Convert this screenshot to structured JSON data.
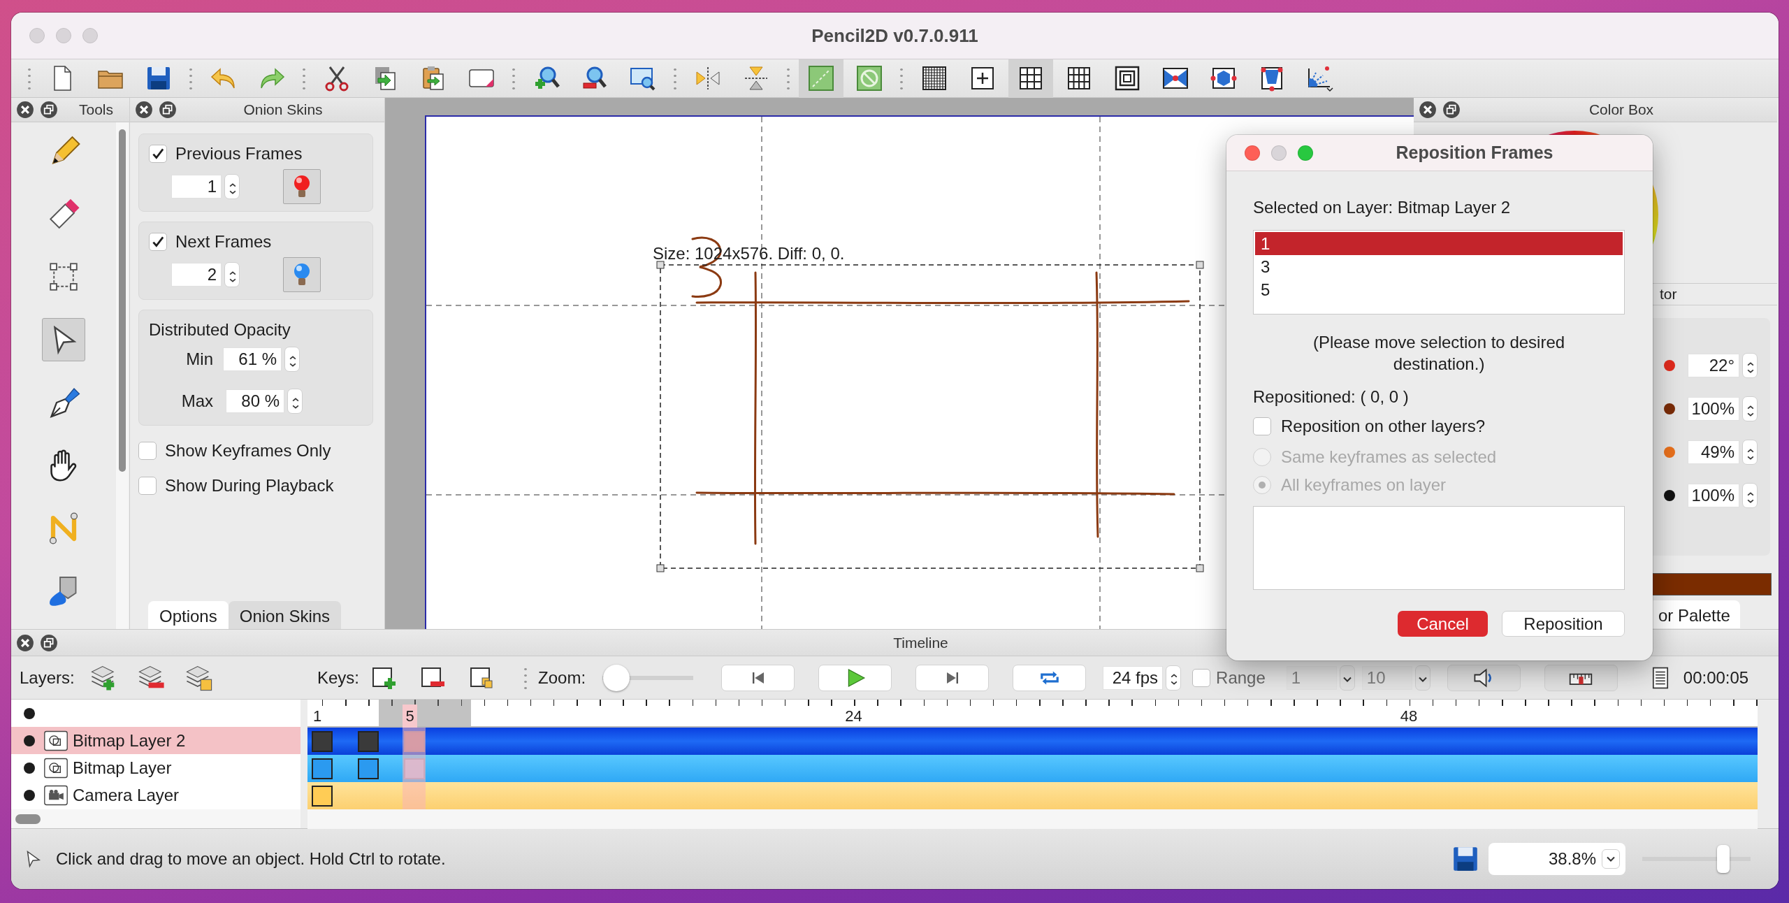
{
  "window": {
    "title": "Pencil2D v0.7.0.911"
  },
  "toolbar_groups": [
    [
      {
        "kind": "new",
        "on": false
      },
      {
        "kind": "open",
        "on": false
      },
      {
        "kind": "save",
        "on": false
      }
    ],
    [
      {
        "kind": "undo",
        "on": false
      },
      {
        "kind": "redo",
        "on": false
      }
    ],
    [
      {
        "kind": "cut",
        "on": false
      },
      {
        "kind": "copy",
        "on": false
      },
      {
        "kind": "paste",
        "on": false
      },
      {
        "kind": "clear",
        "on": false
      }
    ],
    [
      {
        "kind": "zoomin",
        "on": false
      },
      {
        "kind": "zoomout",
        "on": false
      },
      {
        "kind": "zoomfit",
        "on": false
      }
    ],
    [
      {
        "kind": "fliph",
        "on": false
      },
      {
        "kind": "flipv",
        "on": false
      }
    ],
    [
      {
        "kind": "onionprev",
        "on": true
      },
      {
        "kind": "onionnext",
        "on": false
      }
    ],
    [
      {
        "kind": "gridfine",
        "on": false
      },
      {
        "kind": "center",
        "on": false
      },
      {
        "kind": "thirds",
        "on": true
      },
      {
        "kind": "grid",
        "on": false
      },
      {
        "kind": "safe",
        "on": false
      },
      {
        "kind": "bowtie",
        "on": false
      },
      {
        "kind": "hexagon",
        "on": false
      },
      {
        "kind": "trapezoid",
        "on": false
      },
      {
        "kind": "fan",
        "on": false
      }
    ]
  ],
  "tools_panel": {
    "title": "Tools",
    "tools": [
      {
        "kind": "pencil",
        "selected": false
      },
      {
        "kind": "eraser",
        "selected": false
      },
      {
        "kind": "select",
        "selected": false
      },
      {
        "kind": "move",
        "selected": true
      },
      {
        "kind": "pen",
        "selected": false
      },
      {
        "kind": "hand",
        "selected": false
      },
      {
        "kind": "polyline",
        "selected": false
      },
      {
        "kind": "bucket",
        "selected": false
      }
    ]
  },
  "onion_panel": {
    "title": "Onion Skins",
    "previous_frames": {
      "label": "Previous Frames",
      "checked": true,
      "value": "1"
    },
    "next_frames": {
      "label": "Next Frames",
      "checked": true,
      "value": "2"
    },
    "opacity": {
      "title": "Distributed Opacity",
      "min_label": "Min",
      "min_value": "61 %",
      "max_label": "Max",
      "max_value": "80 %"
    },
    "options": [
      {
        "label": "Show Keyframes Only",
        "checked": false
      },
      {
        "label": "Show During Playback",
        "checked": false
      }
    ],
    "tabs": [
      {
        "label": "Options",
        "selected": true
      },
      {
        "label": "Onion Skins",
        "selected": false
      }
    ]
  },
  "canvas": {
    "selection_info": "Size: 1024x576. Diff: 0, 0."
  },
  "color_panel": {
    "title": "Color Box",
    "inspector_title": "tor",
    "values": [
      {
        "value": "22°",
        "color": "#e02a1c"
      },
      {
        "value": "100%",
        "color": "#7a2c08"
      },
      {
        "value": "49%",
        "color": "#e8701c"
      },
      {
        "value": "100%",
        "color": "#111111"
      }
    ],
    "tab": "or Palette"
  },
  "dialog": {
    "title": "Reposition Frames",
    "layer_label": "Selected on Layer: Bitmap Layer 2",
    "frames": [
      {
        "label": "1",
        "selected": true
      },
      {
        "label": "3",
        "selected": false
      },
      {
        "label": "5",
        "selected": false
      }
    ],
    "instruction": "(Please move selection to desired destination.)",
    "repositioned": "Repositioned: ( 0, 0 )",
    "other_layers": {
      "label": "Reposition on other layers?",
      "checked": false
    },
    "scope": [
      {
        "label": "Same keyframes as selected",
        "selected": false,
        "disabled": true
      },
      {
        "label": "All keyframes on layer",
        "selected": true,
        "disabled": true
      }
    ],
    "cancel": "Cancel",
    "confirm": "Reposition"
  },
  "timeline": {
    "title": "Timeline",
    "layers_label": "Layers:",
    "keys_label": "Keys:",
    "zoom_label": "Zoom:",
    "zoom": {
      "level": 0.2
    },
    "fps": "24 fps",
    "range": {
      "label": "Range",
      "checked": false
    },
    "range_start": "1",
    "range_end": "10",
    "time": "00:00:05",
    "ruler_labels": [
      {
        "text": "1",
        "current": false
      },
      {
        "text": "5",
        "current": true
      },
      {
        "text": "24",
        "current": false
      },
      {
        "text": "48",
        "current": false
      }
    ],
    "layers": [
      {
        "name": "Bitmap Layer 2",
        "kind": "bitmap",
        "selected": true,
        "cells": [
          {
            "kind": "key"
          },
          {
            "kind": "empty"
          },
          {
            "kind": "key"
          },
          {
            "kind": "empty"
          },
          {
            "kind": "ghost"
          }
        ]
      },
      {
        "name": "Bitmap Layer",
        "kind": "bitmap",
        "selected": false,
        "cells": [
          {
            "kind": "key"
          },
          {
            "kind": "empty"
          },
          {
            "kind": "key"
          },
          {
            "kind": "empty"
          },
          {
            "kind": "ghost"
          }
        ]
      },
      {
        "name": "Camera Layer",
        "kind": "camera",
        "selected": false,
        "cells": [
          {
            "kind": "key"
          },
          {
            "kind": "empty"
          },
          {
            "kind": "empty"
          },
          {
            "kind": "empty"
          },
          {
            "kind": "empty"
          }
        ]
      }
    ]
  },
  "status": {
    "message": "Click and drag to move an object. Hold Ctrl to rotate.",
    "zoom": "38.8%",
    "scale": {
      "level": 0.72
    }
  }
}
